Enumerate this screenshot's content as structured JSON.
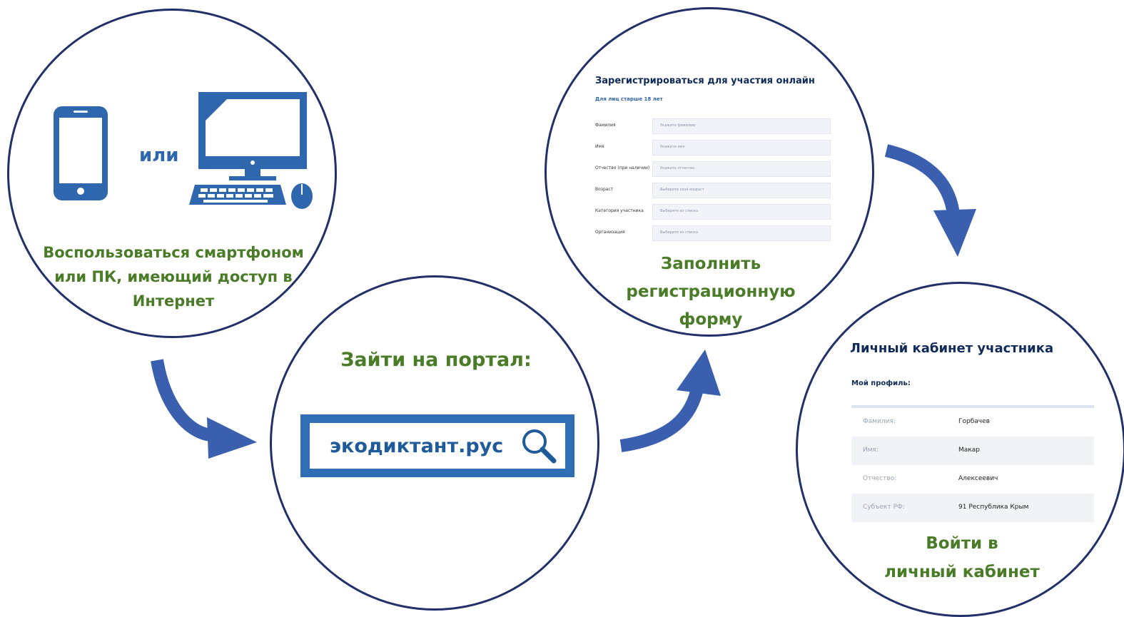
{
  "step1": {
    "or_text": "или",
    "caption_lines": [
      "Воспользоваться смартфоном",
      "или ПК, имеющий доступ в",
      "Интернет"
    ]
  },
  "step2": {
    "title": "Зайти на портал:",
    "search_value": "экодиктант.рус"
  },
  "step3": {
    "form_title": "Зарегистрироваться для участия онлайн",
    "form_subtitle": "Для лиц старше 18 лет",
    "fields": [
      {
        "label": "Фамилия",
        "placeholder": "Укажите фамилию"
      },
      {
        "label": "Имя",
        "placeholder": "Укажите имя"
      },
      {
        "label": "Отчество (при наличии)",
        "placeholder": "Укажите отчество"
      },
      {
        "label": "Возраст",
        "placeholder": "Выберите свой возраст"
      },
      {
        "label": "Категория участника",
        "placeholder": "Выберите из списка"
      },
      {
        "label": "Организация",
        "placeholder": "Выберите из списка"
      }
    ],
    "caption_lines": [
      "Заполнить",
      "регистрационную",
      "форму"
    ]
  },
  "step4": {
    "title": "Личный кабинет участника",
    "subtitle": "Мой профиль:",
    "rows": [
      {
        "label": "Фамилия:",
        "value": "Горбачев"
      },
      {
        "label": "Имя:",
        "value": "Макар"
      },
      {
        "label": "Отчество:",
        "value": "Алексеевич"
      },
      {
        "label": "Субъект РФ:",
        "value": "91 Республика Крым"
      }
    ],
    "caption_lines": [
      "Войти в",
      "личный кабинет"
    ]
  },
  "colors": {
    "circle_border": "#22306a",
    "caption_green": "#4a7c27",
    "icon_blue": "#2f67ae",
    "arrow_blue": "#3a5fae"
  },
  "icons": [
    "smartphone-icon",
    "desktop-computer-icon",
    "search-icon",
    "arrow-icon"
  ]
}
